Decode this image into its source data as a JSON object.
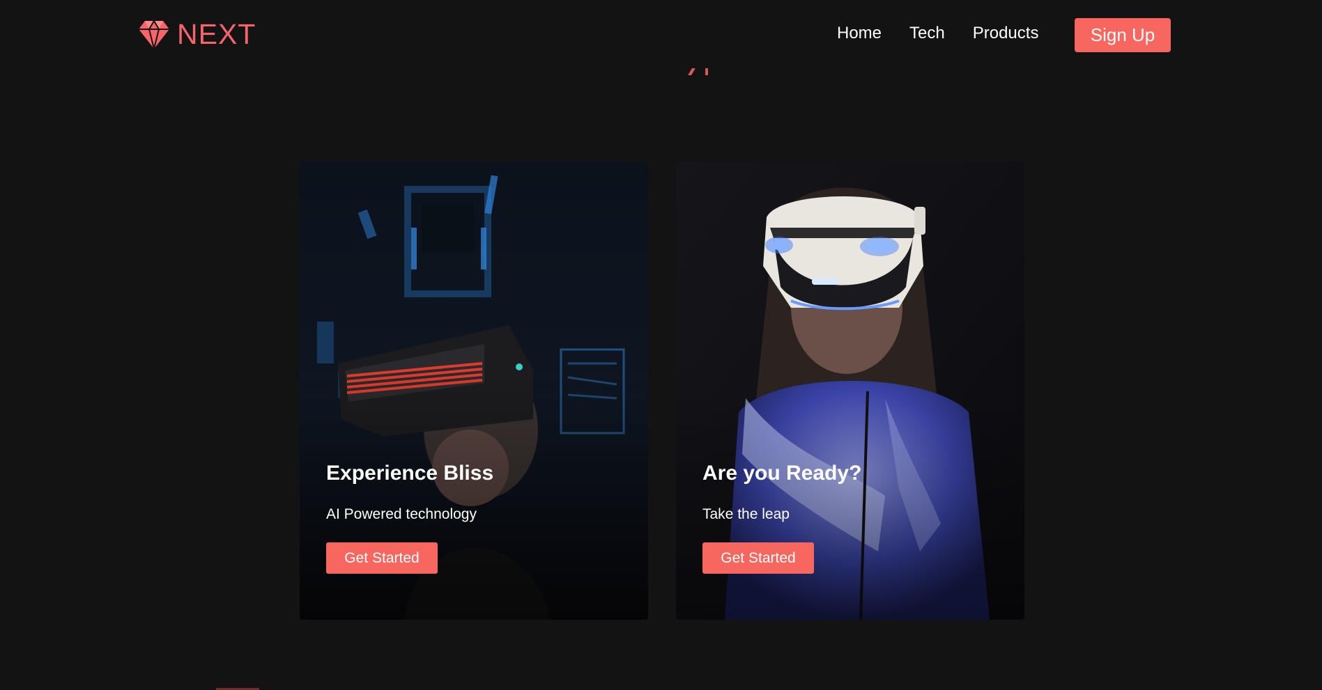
{
  "brand": {
    "name": "NEXT",
    "icon": "diamond-icon",
    "color": "#f8646a"
  },
  "nav": {
    "links": [
      {
        "label": "Home"
      },
      {
        "label": "Tech"
      },
      {
        "label": "Products"
      }
    ],
    "signup_label": "Sign Up"
  },
  "cards": [
    {
      "title": "Experience Bliss",
      "subtitle": "AI Powered technology",
      "button_label": "Get Started",
      "image": "man-wearing-vr-headset-photo"
    },
    {
      "title": "Are you Ready?",
      "subtitle": "Take the leap",
      "button_label": "Get Started",
      "image": "woman-wearing-vr-headset-photo"
    }
  ],
  "colors": {
    "accent": "#f7675f",
    "background": "#131313"
  }
}
